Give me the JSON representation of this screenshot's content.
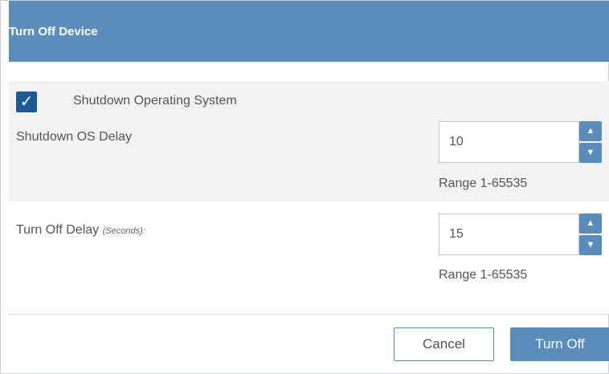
{
  "dialog": {
    "title": "Turn Off Device"
  },
  "shutdown_os": {
    "checkbox_checked": true,
    "checkbox_label": "Shutdown Operating System",
    "delay_label": "Shutdown OS Delay",
    "delay_value": "10",
    "range_text": "Range 1-65535"
  },
  "turn_off": {
    "delay_label": "Turn Off Delay",
    "delay_hint": "(Seconds):",
    "delay_value": "15",
    "range_text": "Range 1-65535"
  },
  "footer": {
    "cancel_label": "Cancel",
    "turn_off_label": "Turn Off"
  },
  "icons": {
    "checkmark": "check-icon",
    "spin_up": "caret-up-icon",
    "spin_down": "caret-down-icon"
  },
  "colors": {
    "header_bg": "#5a8dbb",
    "checkbox_bg": "#1c5a93",
    "section_bg": "#f2f2f2"
  }
}
